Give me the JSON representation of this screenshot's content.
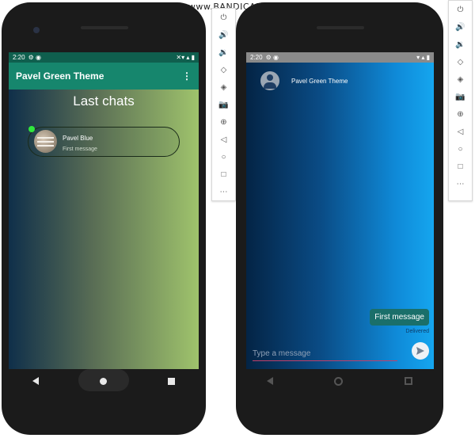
{
  "watermark": "www.BANDICAM.com",
  "left_phone": {
    "status_time": "2:20",
    "status_icons_left": "⚙ ◉",
    "status_icons_right": "✕▾ ▴ ▮",
    "app_title": "Pavel Green Theme",
    "menu_icon": "⋮",
    "heading": "Last chats",
    "chat": {
      "name": "Pavel Blue",
      "last_message": "First message",
      "online": true
    }
  },
  "right_phone": {
    "status_time": "2:20",
    "status_icons_left": "⚙ ◉",
    "status_icons_right": "▾ ▴ ▮",
    "contact_name": "Pavel Green Theme",
    "messages": [
      {
        "text": "First message",
        "status": "Delivered"
      }
    ],
    "input_placeholder": "Type a message"
  },
  "emulator_toolbar": {
    "buttons": [
      "power-icon",
      "volume-up-icon",
      "volume-down-icon",
      "rotate-left-icon",
      "rotate-right-icon",
      "camera-icon",
      "zoom-icon",
      "back-icon",
      "home-icon",
      "overview-icon",
      "more-icon"
    ],
    "glyphs": [
      "⏻",
      "🔊",
      "🔉",
      "◇",
      "◈",
      "📷",
      "⊕",
      "◁",
      "○",
      "□",
      "⋯"
    ]
  },
  "colors": {
    "green_appbar": "#16866d",
    "green_statusbar": "#0f5f4e",
    "online": "#30e83d",
    "bubble": "#1a6f6a",
    "input_underline": "#c0406a"
  }
}
